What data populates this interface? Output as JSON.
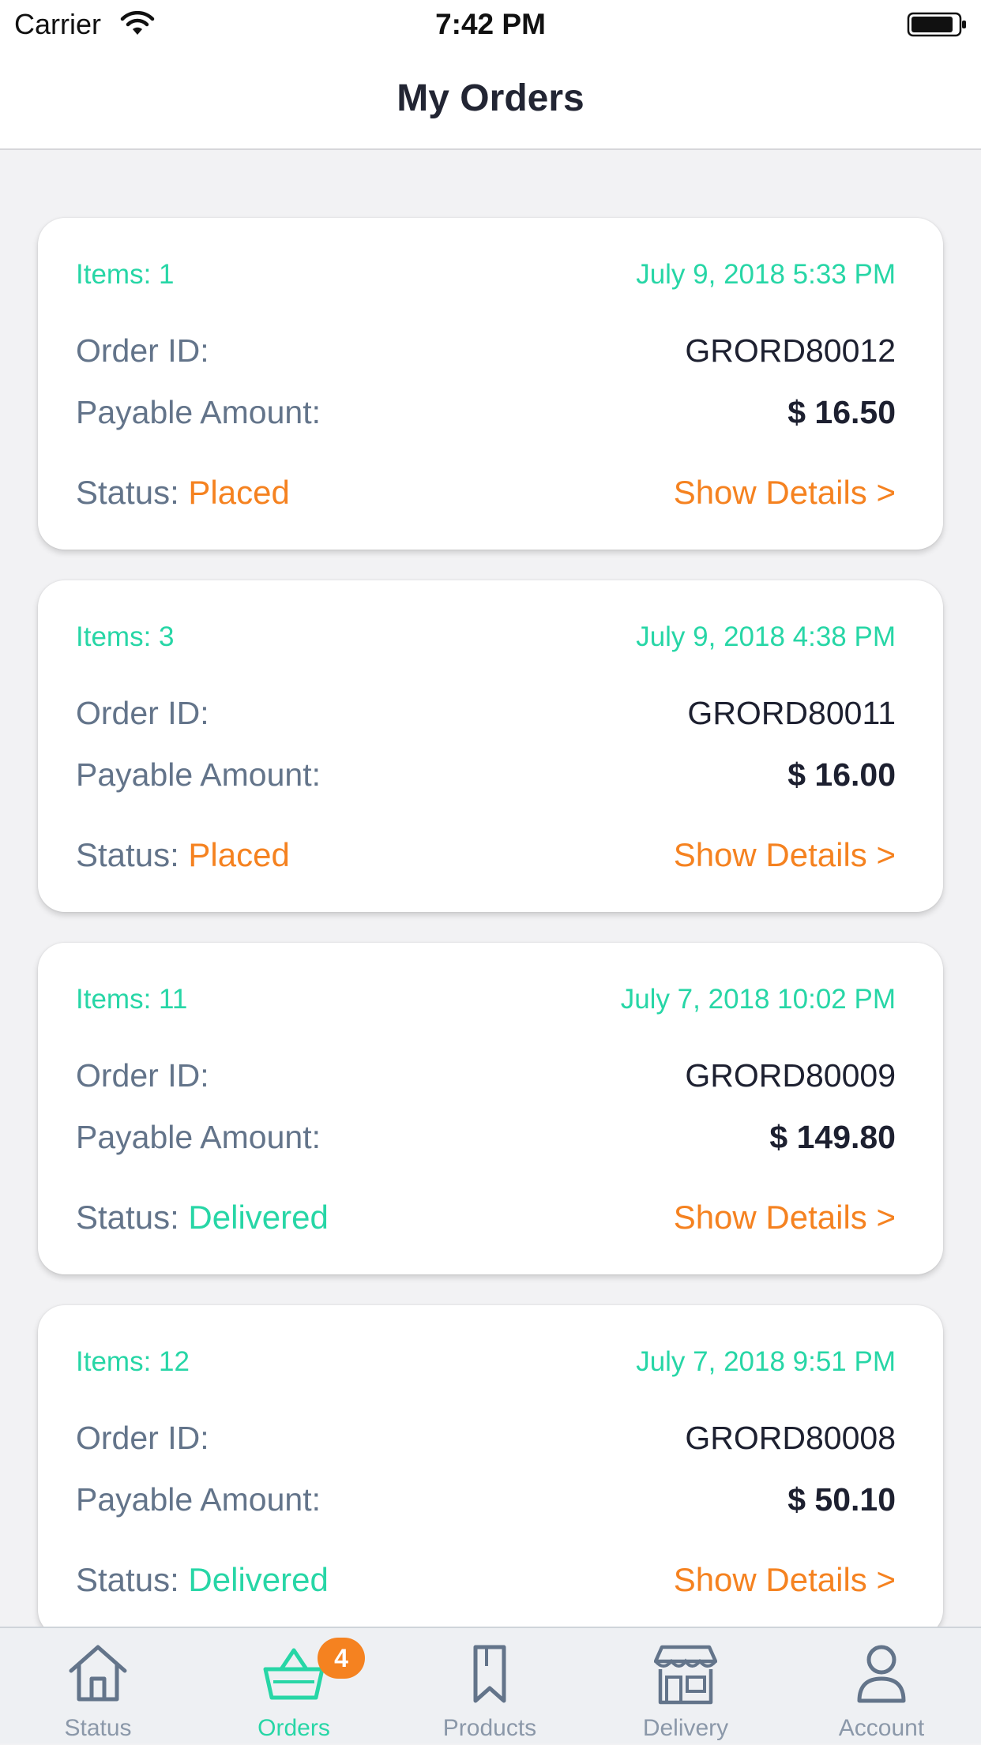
{
  "status_bar": {
    "carrier": "Carrier",
    "time": "7:42 PM",
    "wifi_icon": "wifi-icon",
    "battery_icon": "battery-icon"
  },
  "nav": {
    "title": "My Orders"
  },
  "labels": {
    "order_id": "Order ID:",
    "payable_amount": "Payable Amount:",
    "status": "Status:",
    "show_details": "Show Details >"
  },
  "orders": [
    {
      "items": "Items: 1",
      "datetime": "July 9, 2018 5:33 PM",
      "order_id": "GRORD80012",
      "amount": "$ 16.50",
      "status": "Placed"
    },
    {
      "items": "Items: 3",
      "datetime": "July 9, 2018 4:38 PM",
      "order_id": "GRORD80011",
      "amount": "$ 16.00",
      "status": "Placed"
    },
    {
      "items": "Items: 11",
      "datetime": "July 7, 2018 10:02 PM",
      "order_id": "GRORD80009",
      "amount": "$ 149.80",
      "status": "Delivered"
    },
    {
      "items": "Items: 12",
      "datetime": "July 7, 2018 9:51 PM",
      "order_id": "GRORD80008",
      "amount": "$ 50.10",
      "status": "Delivered"
    }
  ],
  "tabs": [
    {
      "label": "Status",
      "icon": "home-icon"
    },
    {
      "label": "Orders",
      "icon": "basket-icon",
      "badge": "4",
      "active": true
    },
    {
      "label": "Products",
      "icon": "bookmark-icon"
    },
    {
      "label": "Delivery",
      "icon": "store-icon"
    },
    {
      "label": "Account",
      "icon": "person-icon"
    }
  ],
  "colors": {
    "accent": "#27d6a6",
    "orange": "#f58220",
    "label_gray": "#63748a",
    "text_dark": "#1d2030",
    "tab_inactive": "#8b98a9"
  }
}
